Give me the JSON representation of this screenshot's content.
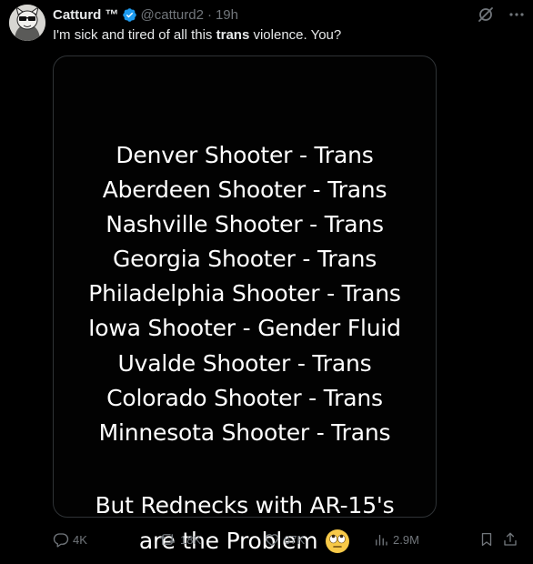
{
  "tweet": {
    "display_name": "Catturd ™",
    "handle": "@catturd2",
    "separator": "·",
    "time": "19h",
    "text_before": "I'm sick and tired of all this ",
    "text_bold": "trans",
    "text_after": " violence. You?"
  },
  "media": {
    "lines": [
      "Denver Shooter - Trans",
      "Aberdeen Shooter - Trans",
      "Nashville Shooter - Trans",
      "Georgia Shooter - Trans",
      "Philadelphia Shooter - Trans",
      "Iowa Shooter - Gender Fluid",
      "Uvalde Shooter - Trans",
      "Colorado Shooter - Trans",
      "Minnesota Shooter - Trans"
    ],
    "tagline_1": "But Rednecks with AR-15's",
    "tagline_2": "are the Problem",
    "emoji": "face-with-rolling-eyes"
  },
  "metrics": {
    "replies": "4K",
    "reposts": "18K",
    "likes": "67K",
    "views": "2.9M"
  },
  "icons": {
    "verified": "verified-badge-icon",
    "grok": "grok-icon",
    "more": "more-icon",
    "reply": "reply-icon",
    "repost": "repost-icon",
    "like": "like-icon",
    "views": "views-icon",
    "bookmark": "bookmark-icon",
    "share": "share-icon"
  },
  "colors": {
    "background": "#000000",
    "text": "#e7e9ea",
    "muted": "#71767b",
    "verified": "#1d9bf0",
    "media_border": "#2f3336"
  }
}
